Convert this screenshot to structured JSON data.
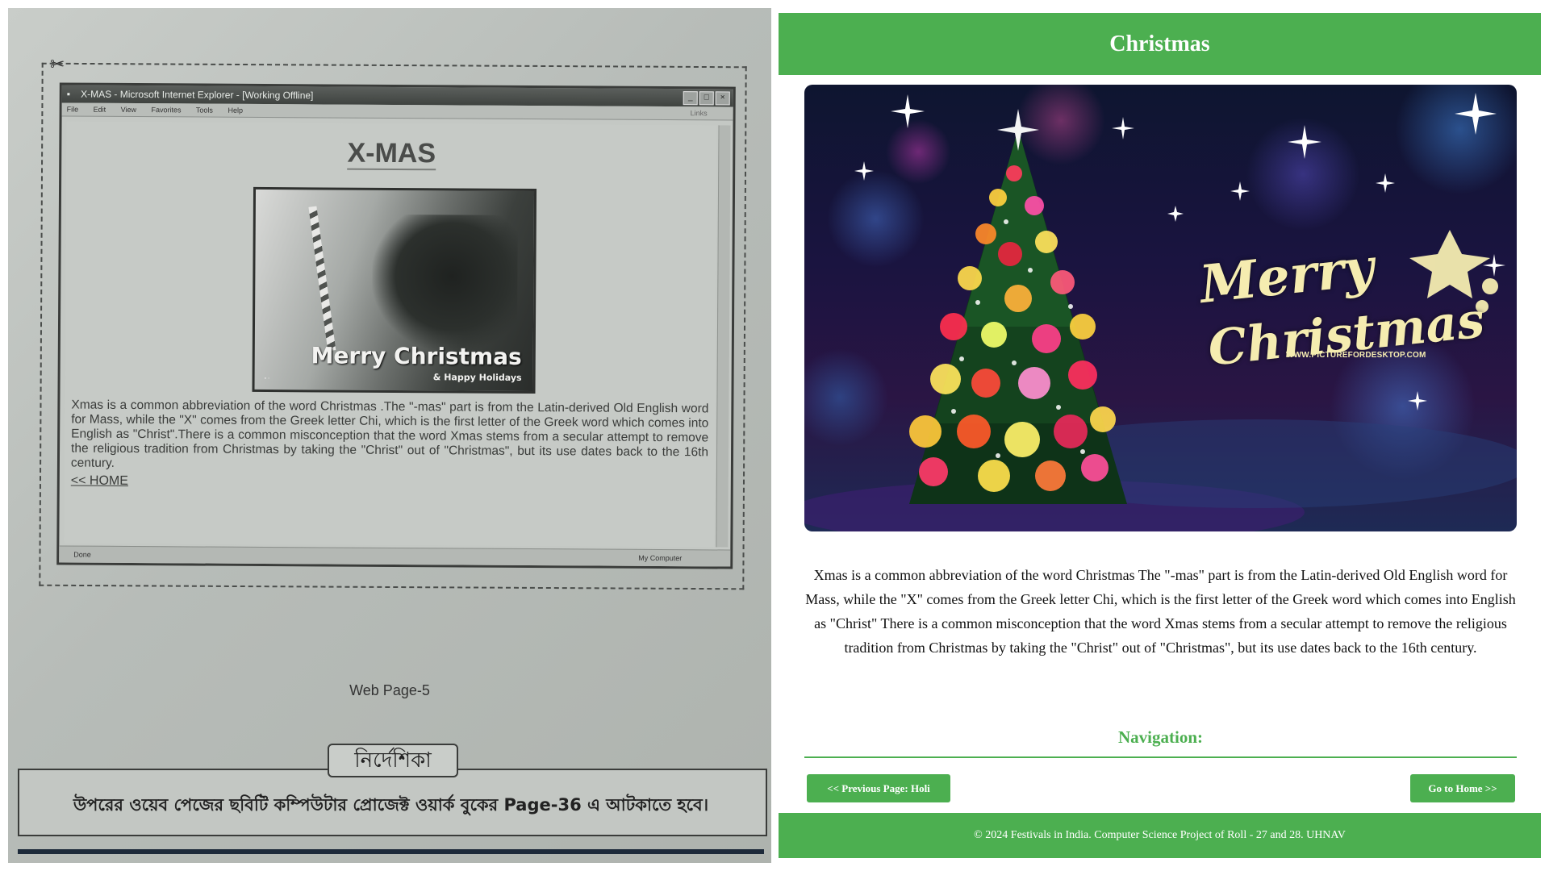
{
  "photo": {
    "browser": {
      "window_title": "X-MAS - Microsoft Internet Explorer - [Working Offline]",
      "menu": [
        "File",
        "Edit",
        "View",
        "Favorites",
        "Tools",
        "Help"
      ],
      "links_label": "Links",
      "page_title": "X-MAS",
      "image_text_main": "Merry Christmas",
      "image_text_sub": "& Happy Holidays",
      "body_text": "Xmas is a common abbreviation of the word Christmas .The \"-mas\" part is from the Latin-derived Old English word for Mass, while the \"X\" comes from the Greek letter Chi, which is the first letter of the Greek word which comes into English as \"Christ\".There is a common misconception that the word Xmas stems from a secular attempt to remove the religious tradition from Christmas by taking the \"Christ\" out of \"Christmas\", but its use dates back to the 16th century.",
      "home_link": "<< HOME",
      "status_left": "Done",
      "status_right": "My Computer"
    },
    "caption": "Web Page-5",
    "guide_label": "নির্দেশিকা",
    "guide_text": "উপরের ওয়েব পেজের ছবিটি কম্পিউটার প্রোজেক্ট ওয়ার্ক বুকের Page-36 এ আটকাতে হবে।"
  },
  "site": {
    "header_title": "Christmas",
    "hero": {
      "greeting_line1": "Merry",
      "greeting_line2": "Christmas",
      "watermark": "WWW.PICTUREFORDESKTOP.COM"
    },
    "description": "Xmas is a common abbreviation of the word Christmas The \"-mas\" part is from the Latin-derived Old English word for Mass, while the \"X\" comes from the Greek letter Chi, which is the first letter of the Greek word which comes into English as \"Christ\" There is a common misconception that the word Xmas stems from a secular attempt to remove the religious tradition from Christmas by taking the \"Christ\" out of \"Christmas\", but its use dates back to the 16th century.",
    "nav_heading": "Navigation:",
    "prev_button": "<< Previous Page: Holi",
    "home_button": "Go to Home >>",
    "footer": "© 2024 Festivals in India. Computer Science Project of Roll - 27 and 28. UHNAV"
  },
  "colors": {
    "accent": "#4caf50",
    "header_text": "#ffffff",
    "body_text": "#111111"
  },
  "icons": [
    "scissors-icon",
    "ie-page-icon",
    "minimize-icon",
    "maximize-icon",
    "close-icon",
    "christmas-tree-icon",
    "sparkle-icon"
  ]
}
